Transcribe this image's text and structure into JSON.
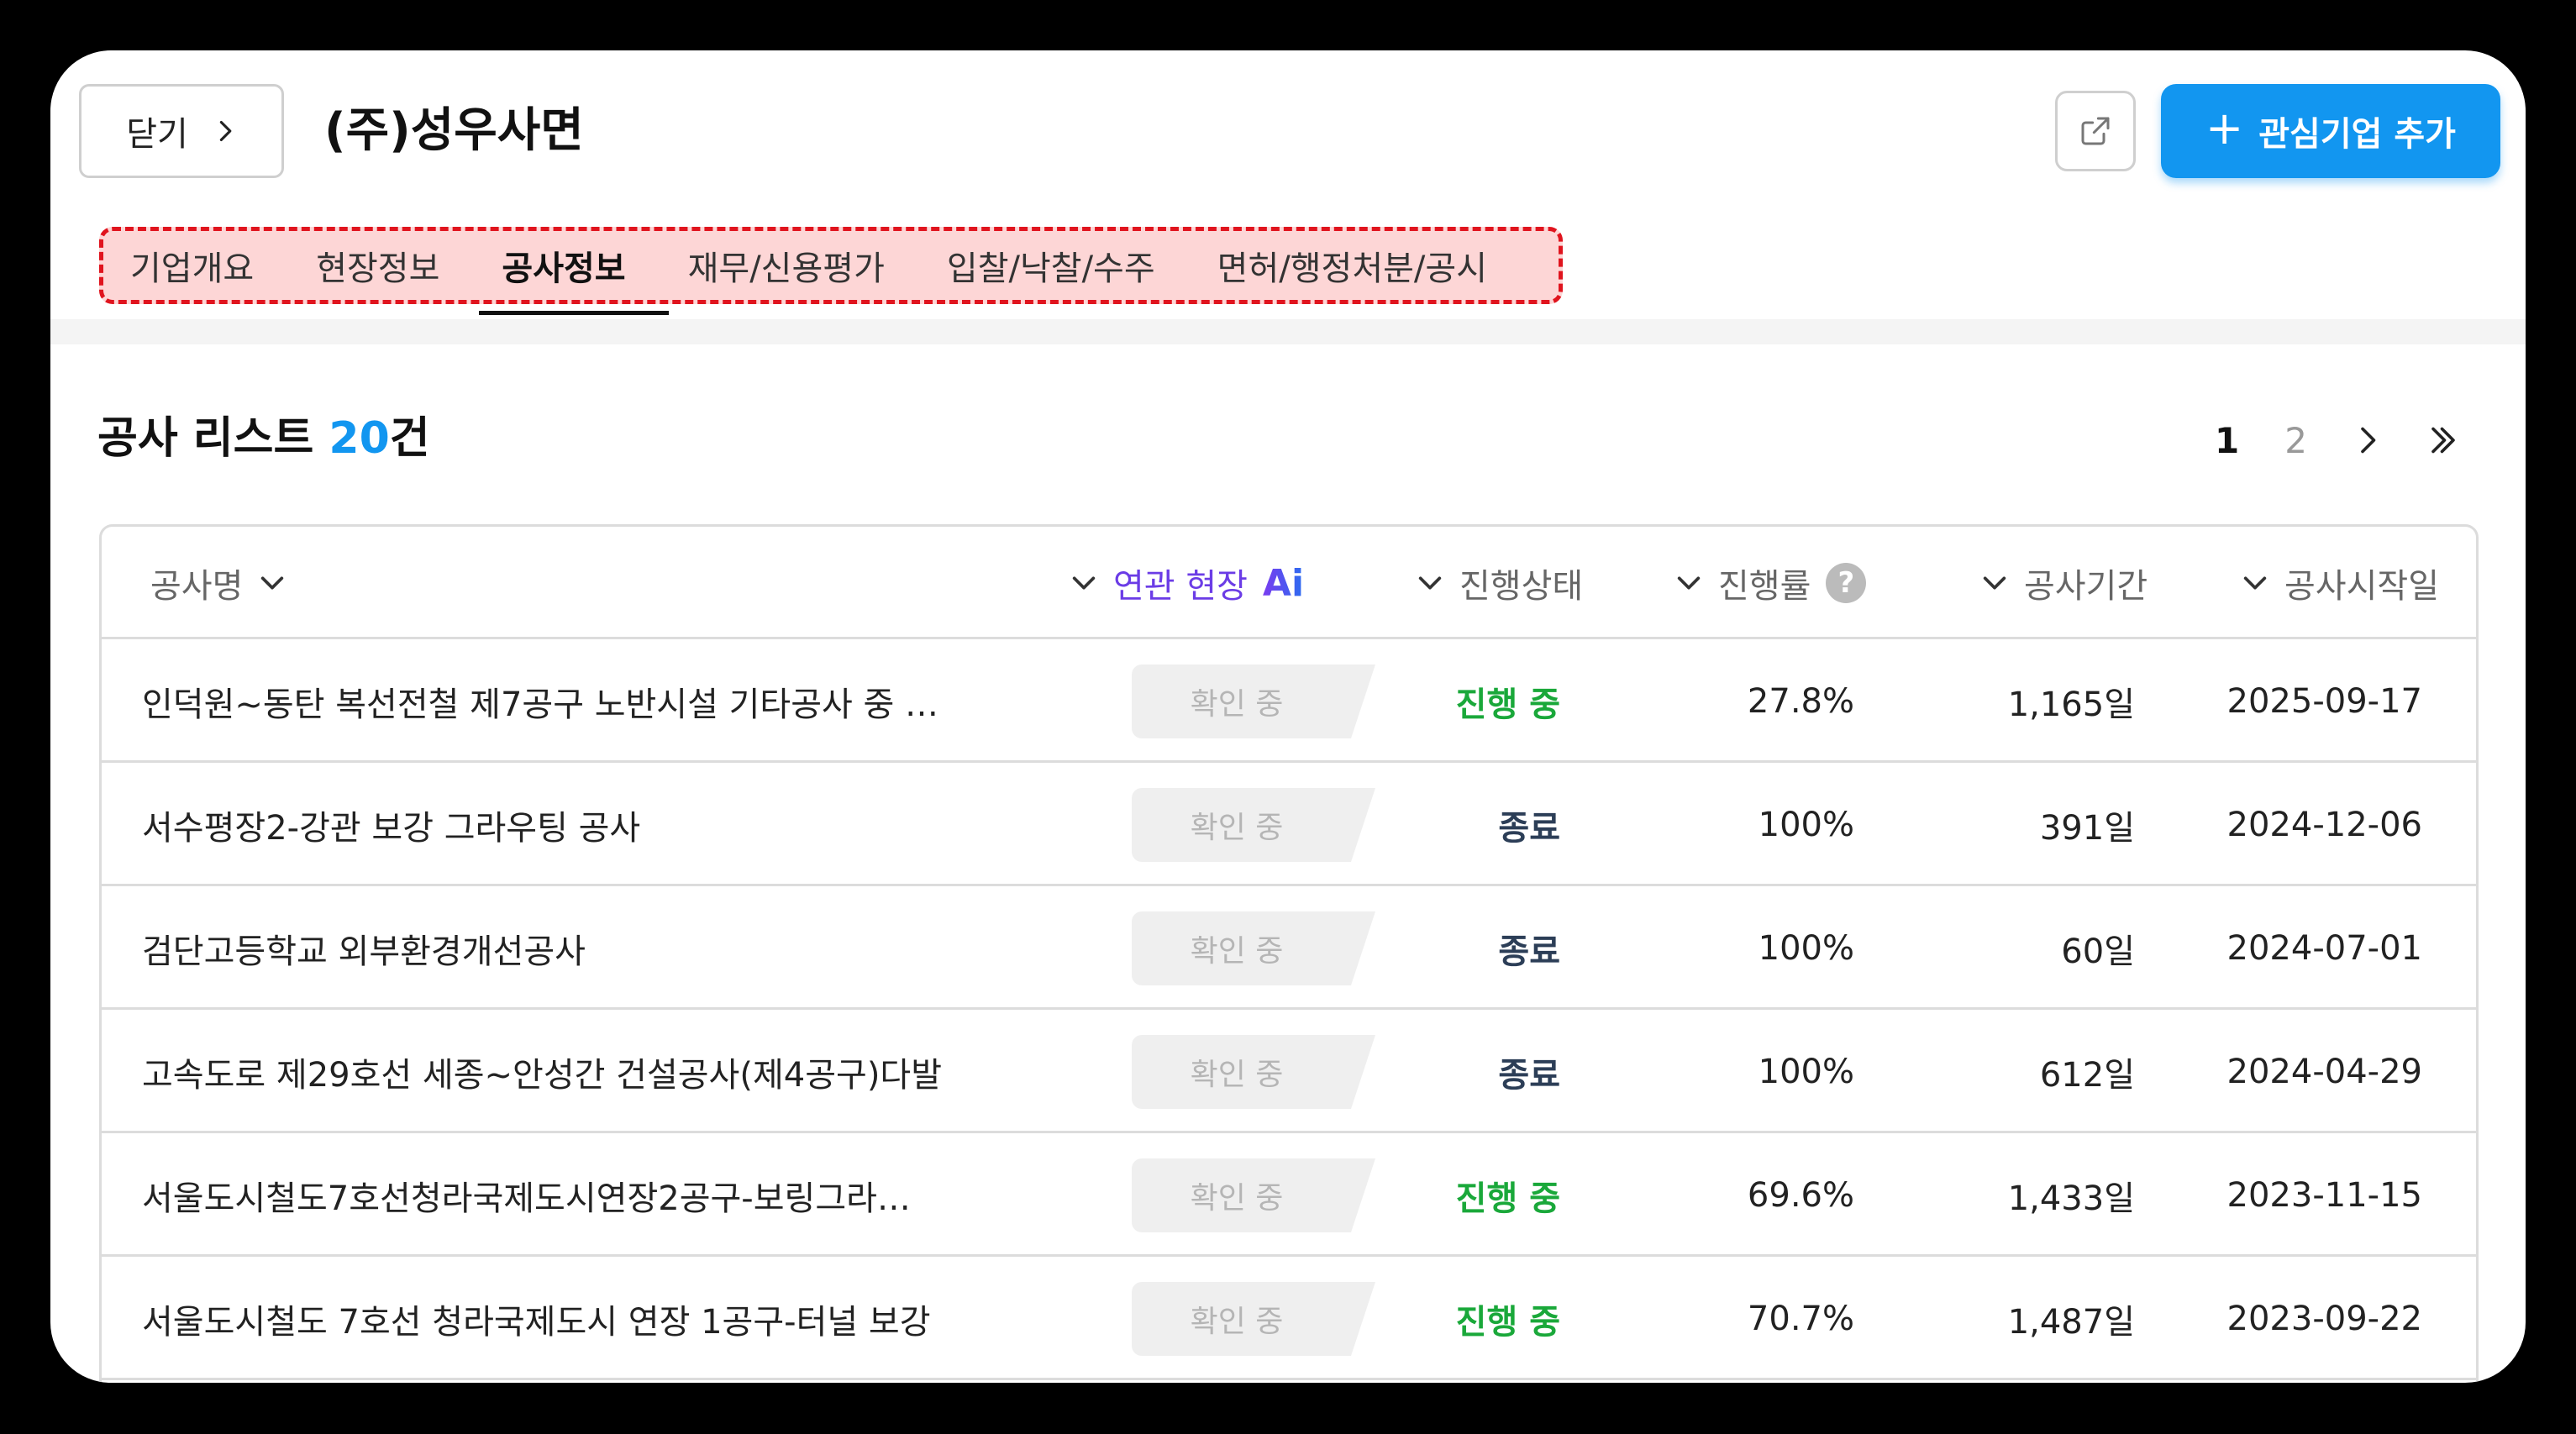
{
  "header": {
    "close_label": "닫기",
    "company_name": "(주)성우사면",
    "add_button_label": "관심기업 추가"
  },
  "tabs": [
    {
      "label": "기업개요"
    },
    {
      "label": "현장정보"
    },
    {
      "label": "공사정보",
      "active": true
    },
    {
      "label": "재무/신용평가"
    },
    {
      "label": "입찰/낙찰/수주"
    },
    {
      "label": "면허/행정처분/공시"
    }
  ],
  "list": {
    "title_prefix": "공사 리스트 ",
    "count": "20",
    "title_suffix": "건"
  },
  "pagination": {
    "pages": [
      "1",
      "2"
    ],
    "current": "1"
  },
  "table": {
    "columns": {
      "name": "공사명",
      "related": "연관 현장",
      "ai": "Ai",
      "status": "진행상태",
      "progress": "진행률",
      "help": "?",
      "duration": "공사기간",
      "start": "공사시작일"
    },
    "rows": [
      {
        "name": "인덕원~동탄 복선전철 제7공구 노반시설 기타공사 중 …",
        "related": "확인 중",
        "status": "진행 중",
        "status_type": "ongoing",
        "progress": "27.8%",
        "duration": "1,165일",
        "start": "2025-09-17"
      },
      {
        "name": "서수평장2-강관 보강 그라우팅 공사",
        "related": "확인 중",
        "status": "종료",
        "status_type": "done",
        "progress": "100%",
        "duration": "391일",
        "start": "2024-12-06"
      },
      {
        "name": "검단고등학교 외부환경개선공사",
        "related": "확인 중",
        "status": "종료",
        "status_type": "done",
        "progress": "100%",
        "duration": "60일",
        "start": "2024-07-01"
      },
      {
        "name": "고속도로 제29호선 세종~안성간 건설공사(제4공구)다발",
        "related": "확인 중",
        "status": "종료",
        "status_type": "done",
        "progress": "100%",
        "duration": "612일",
        "start": "2024-04-29"
      },
      {
        "name": "서울도시철도7호선청라국제도시연장2공구-보링그라…",
        "related": "확인 중",
        "status": "진행 중",
        "status_type": "ongoing",
        "progress": "69.6%",
        "duration": "1,433일",
        "start": "2023-11-15"
      },
      {
        "name": "서울도시철도 7호선 청라국제도시 연장 1공구-터널 보강",
        "related": "확인 중",
        "status": "진행 중",
        "status_type": "ongoing",
        "progress": "70.7%",
        "duration": "1,487일",
        "start": "2023-09-22"
      }
    ]
  },
  "colors": {
    "accent": "#1296f0",
    "ongoing": "#1aa83a",
    "done": "#2c3e57",
    "tab_highlight_border": "#e0141e",
    "tab_highlight_bg": "#fdd6d6"
  }
}
